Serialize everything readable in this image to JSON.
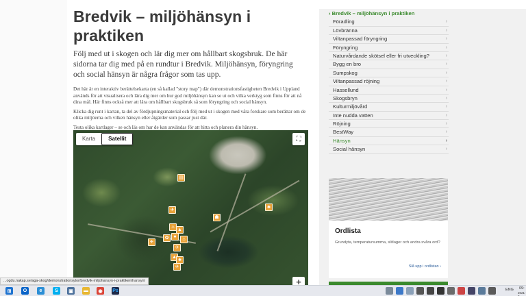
{
  "page": {
    "title": "Bredvik – miljöhänsyn i praktiken",
    "lead": "Följ med ut i skogen och lär dig mer om hållbart skogsbruk. De här sidorna tar dig med på en rundtur i Bredvik. Miljöhänsyn, föryngring och social hänsyn är några frågor som tas upp.",
    "paragraphs": [
      "Det här är en interaktiv berättelsekarta (en så kallad \"story map\") där demonstrationsfastigheten Bredvik i Uppland används för att visualisera och lära dig mer om hur god miljöhänsyn kan se ut och vilka verktyg som finns för att nå dina mål. Här finns också mer att lära om hållbart skogsbruk så som föryngring och social hänsyn.",
      "Klicka dig runt i kartan, ta del av fördjupningsmaterial och följ med ut i skogen med våra forskare som berättar om de olika miljöerna och vilken hänsyn eller åtgärder som passar just där.",
      "Testa olika kartlager – se och läs om hur de kan användas för att hitta och planera din hänsyn."
    ]
  },
  "map": {
    "tab_map": "Karta",
    "tab_satellite": "Satellit",
    "active_tab": "Satellit",
    "fullscreen_icon": "fullscreen-icon",
    "zoom_in": "+",
    "marker_color": "#e9a33a"
  },
  "sidebar": {
    "current": "Bredvik – miljöhänsyn i praktiken",
    "items": [
      "Föradling",
      "Lövbränna",
      "Viltanpassad föryngring",
      "Föryngring",
      "Naturvårdande skötsel eller fri utveckling?",
      "Bygg en bro",
      "Sumpskog",
      "Viltanpassad röjning",
      "Hassellund",
      "Skogsbryn",
      "Kulturmiljövård",
      "Inte nudda vatten",
      "Röjning",
      "BestWay",
      "Hänsyn",
      "Social hänsyn"
    ],
    "selected": "Hänsyn",
    "accent": "#3b8a2e"
  },
  "card": {
    "title": "Ordlista",
    "text": "Grundyta, temperatursumma, slitlager och andra svåra ord?",
    "link": "Slå upp i ordlistan"
  },
  "status": {
    "url": "...ogdu.nakap.se/aga-skog/demonstrationsytor/bredvik-miljohansyn-i-praktiken/hansyn/"
  },
  "taskbar": {
    "lang": "ENG",
    "time": "09:",
    "date": "2021-0"
  }
}
